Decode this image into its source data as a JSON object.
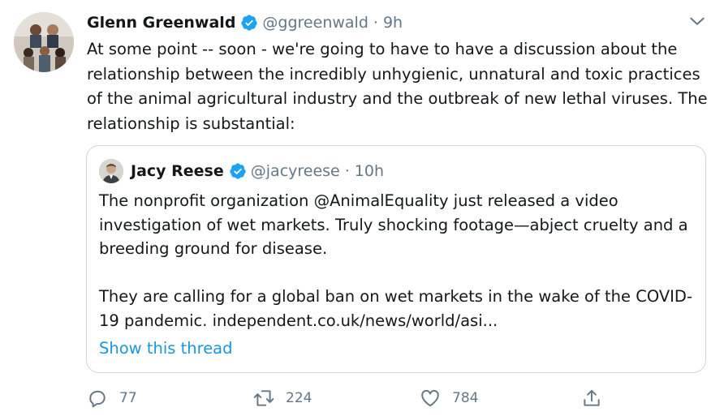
{
  "tweet": {
    "author_name": "Glenn Greenwald",
    "author_handle": "@ggreenwald",
    "separator": "·",
    "time": "9h",
    "text": "At some point -- soon - we're going to have to have a discussion about the relationship between the incredibly unhygienic, unnatural and toxic practices of the animal agricultural industry and the outbreak of new lethal viruses.  The relationship is substantial:"
  },
  "quoted": {
    "author_name": "Jacy Reese",
    "author_handle": "@jacyreese",
    "separator": "·",
    "time": "10h",
    "paragraph1": "The nonprofit organization @AnimalEquality just released a video investigation of wet markets. Truly shocking footage—abject cruelty and a breeding ground for disease.",
    "paragraph2": "They are calling for a global ban on wet markets in the wake of the COVID-19 pandemic. independent.co.uk/news/world/asi...",
    "show_thread": "Show this thread"
  },
  "actions": {
    "replies": "77",
    "retweets": "224",
    "likes": "784"
  },
  "colors": {
    "verified": "#1da1f2",
    "muted": "#657786",
    "link": "#1b95e0",
    "border": "#ccd6dd"
  }
}
